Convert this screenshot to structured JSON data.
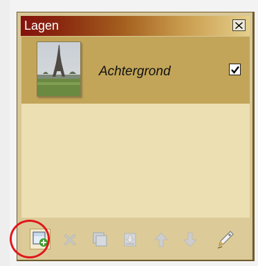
{
  "panel": {
    "title": "Lagen",
    "close_icon": "close-x-icon"
  },
  "layers": [
    {
      "name": "Achtergrond",
      "visible": true,
      "thumbnail": "eiffel-tower-photo"
    }
  ],
  "toolbar": {
    "buttons": [
      {
        "name": "add-layer",
        "icon": "new-layer-icon",
        "enabled": true,
        "highlighted": true
      },
      {
        "name": "delete-layer",
        "icon": "delete-x-icon",
        "enabled": false
      },
      {
        "name": "duplicate-layer",
        "icon": "duplicate-layer-icon",
        "enabled": false
      },
      {
        "name": "merge-down",
        "icon": "merge-down-icon",
        "enabled": false
      },
      {
        "name": "move-up",
        "icon": "arrow-up-icon",
        "enabled": false
      },
      {
        "name": "move-down",
        "icon": "arrow-down-icon",
        "enabled": false
      },
      {
        "name": "layer-properties",
        "icon": "properties-tag-icon",
        "enabled": true
      }
    ]
  },
  "colors": {
    "title_gradient_start": "#84120e",
    "title_gradient_end": "#e5cf8a",
    "selected_row": "#c2a559",
    "list_background": "#ecdfb2",
    "highlight_circle": "#e0161c"
  }
}
